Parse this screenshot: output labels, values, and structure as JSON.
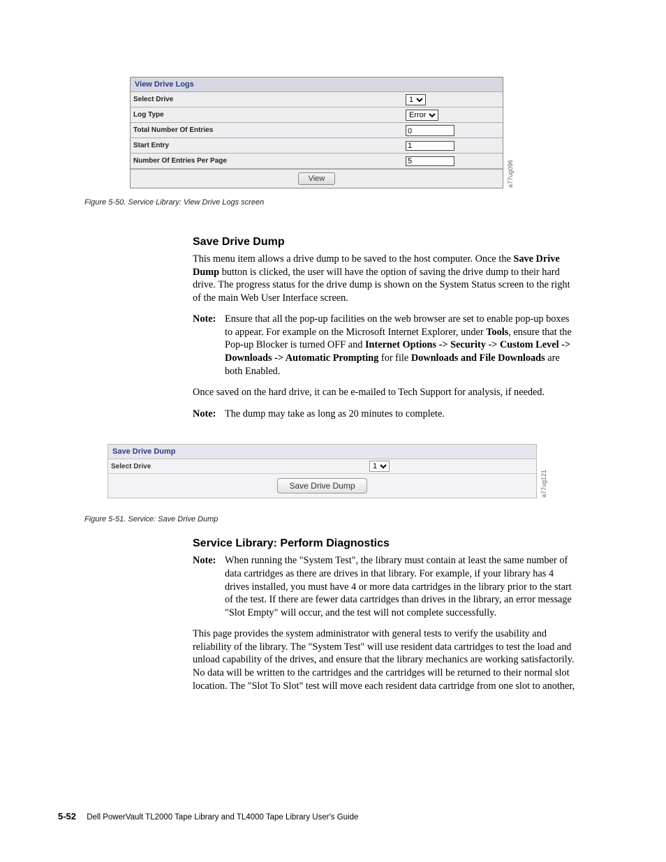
{
  "panel1": {
    "title": "View Drive Logs",
    "rows": {
      "select_drive": {
        "label": "Select Drive",
        "value": "1"
      },
      "log_type": {
        "label": "Log Type",
        "value": "Error"
      },
      "total_entries": {
        "label": "Total Number Of Entries",
        "value": "0"
      },
      "start_entry": {
        "label": "Start Entry",
        "value": "1"
      },
      "entries_per_page": {
        "label": "Number Of Entries Per Page",
        "value": "5"
      }
    },
    "button": "View",
    "side_label": "a77ug096"
  },
  "figcaption1": "Figure 5-50. Service Library: View Drive Logs screen",
  "section1": {
    "heading": "Save Drive Dump",
    "para1_pre": "This menu item allows a drive dump to be saved to the host computer. Once the ",
    "para1_bold": "Save Drive Dump",
    "para1_post": " button is clicked, the user will have the option of saving the drive dump to their hard drive. The progress status for the drive dump is shown on the System Status screen to the right of the main Web User Interface screen.",
    "note1": {
      "label": "Note:",
      "text_pre": "Ensure that all the pop-up facilities on the web browser are set to enable pop-up boxes to appear. For example on the Microsoft Internet Explorer, under ",
      "b1": "Tools",
      "mid1": ", ensure that the Pop-up Blocker is turned OFF and ",
      "b2": "Internet Options -> Security -> Custom Level -> Downloads -> Automatic Prompting",
      "mid2": " for file ",
      "b3": "Downloads and File Downloads",
      "post": " are both Enabled."
    },
    "para2": "Once saved on the hard drive, it can be e-mailed to Tech Support for analysis, if needed.",
    "note2": {
      "label": "Note:",
      "text": "The dump may take as long as 20 minutes to complete."
    }
  },
  "panel2": {
    "title": "Save Drive Dump",
    "select_drive_label": "Select Drive",
    "select_drive_value": "1",
    "button": "Save Drive Dump",
    "side_label": "a77ug121"
  },
  "figcaption2": "Figure 5-51. Service: Save Drive Dump",
  "section2": {
    "heading": "Service Library: Perform Diagnostics",
    "note": {
      "label": "Note:",
      "text": "When running the \"System Test\", the library must contain at least the same number of data cartridges as there are drives in that library. For example, if your library has 4 drives installed, you must have 4 or more data cartridges in the library prior to the start of the test. If there are fewer data cartridges than drives in the library, an error message \"Slot Empty\" will occur, and the test will not complete successfully."
    },
    "para": "This page provides the system administrator with general tests to verify the usability and reliability of the library. The \"System Test\" will use resident data cartridges to test the load and unload capability of the drives, and ensure that the library mechanics are working satisfactorily. No data will be written to the cartridges and the cartridges will be returned to their normal slot location. The \"Slot To Slot\" test will move each resident data cartridge from one slot to another,"
  },
  "footer": {
    "page": "5-52",
    "doc": "Dell PowerVault TL2000 Tape Library and TL4000 Tape Library User's Guide"
  }
}
